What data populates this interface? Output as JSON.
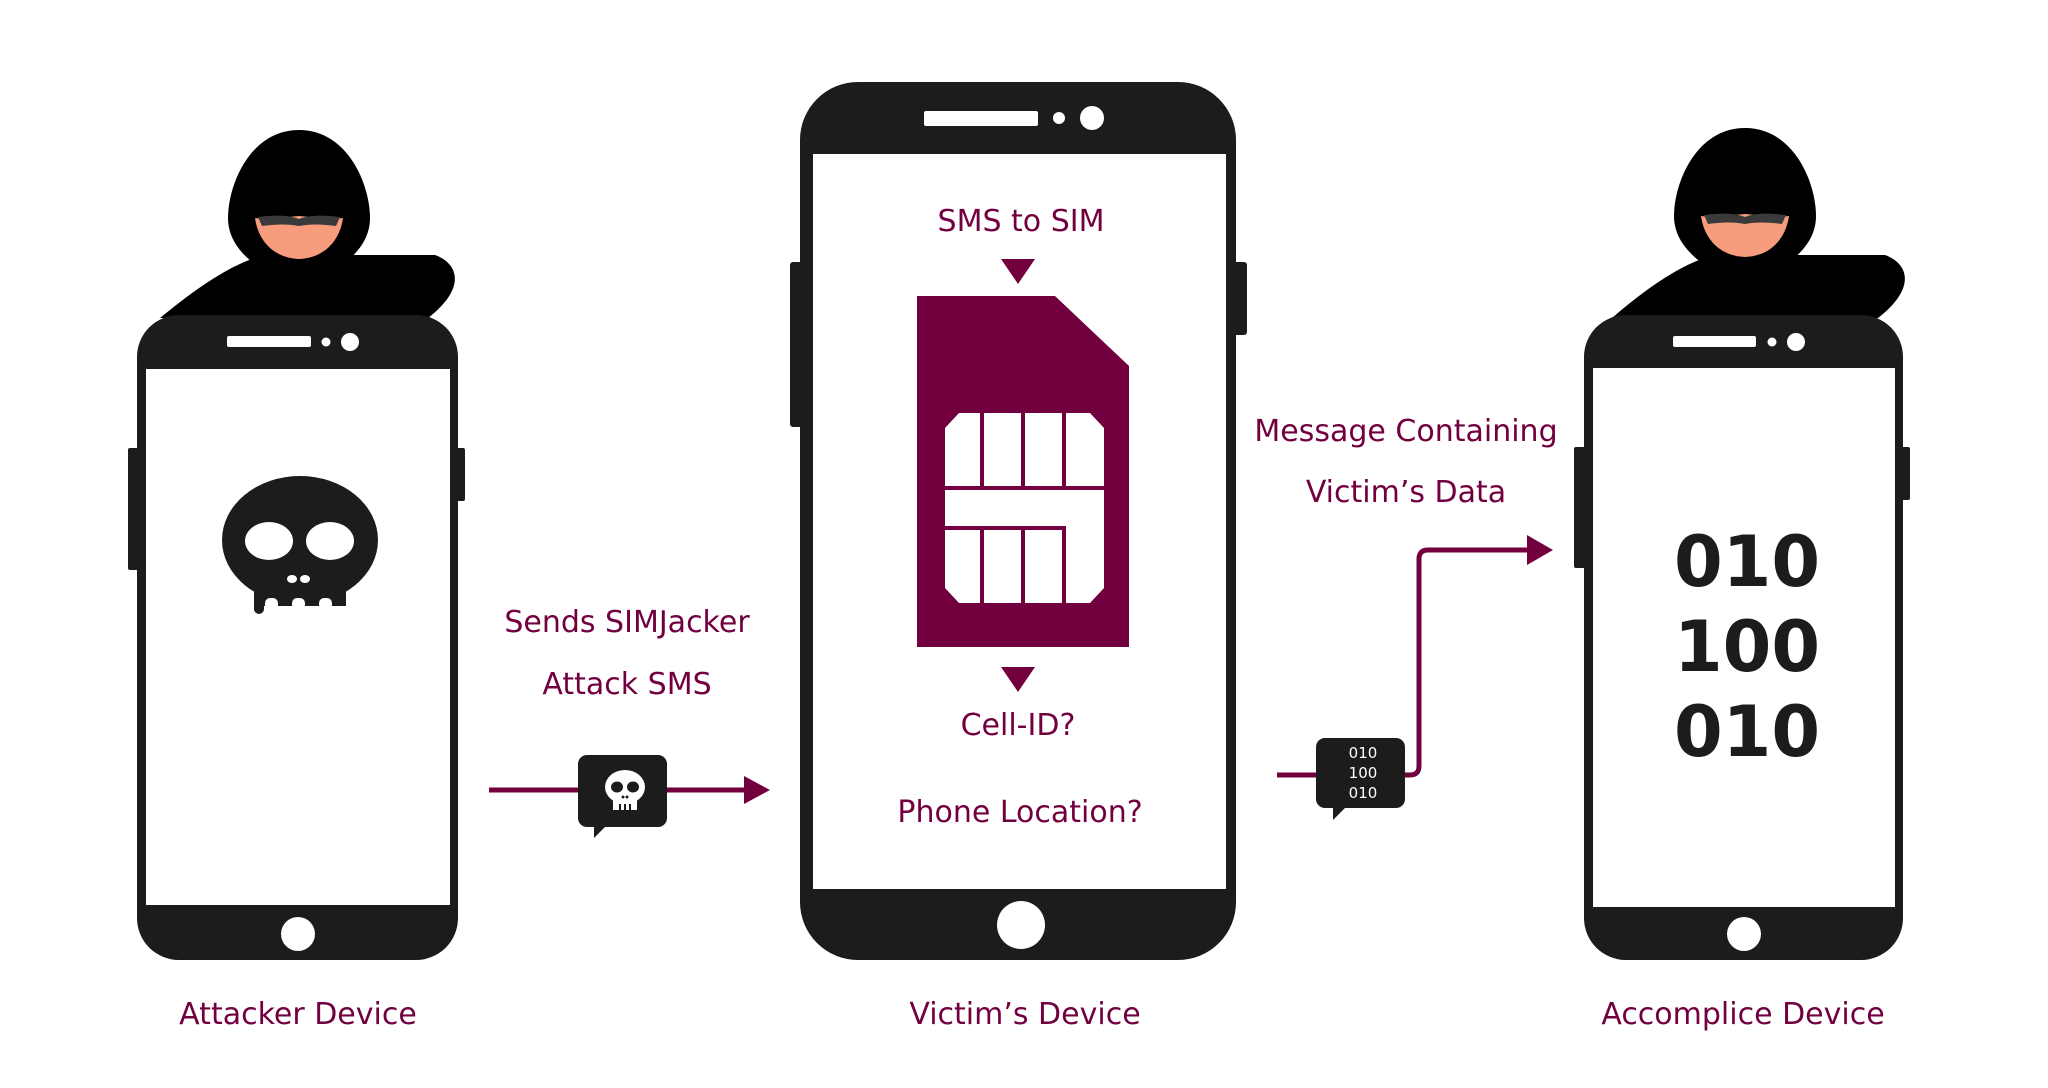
{
  "colors": {
    "accent": "#72003F",
    "device": "#1c1c1c",
    "hood": "#000000",
    "face": "#F79C7C",
    "glasses": "#3a3a3a",
    "screen": "#ffffff"
  },
  "devices": {
    "attacker": {
      "label": "Attacker Device",
      "screen_icon": "skull-icon"
    },
    "victim": {
      "label": "Victim’s Device",
      "screen_icon": "sim-card-icon"
    },
    "accomplice": {
      "label": "Accomplice Device",
      "screen_lines": [
        "010",
        "100",
        "010"
      ]
    }
  },
  "victim_screen": {
    "top_text": "SMS to SIM",
    "question_1": "Cell-ID?",
    "question_2": "Phone Location?"
  },
  "flows": {
    "attack": {
      "line_1": "Sends SIMJacker",
      "line_2": "Attack SMS",
      "bubble_icon": "skull-icon"
    },
    "exfil": {
      "line_1": "Message Containing",
      "line_2": "Victim’s Data",
      "bubble_lines": [
        "010",
        "100",
        "010"
      ]
    }
  }
}
